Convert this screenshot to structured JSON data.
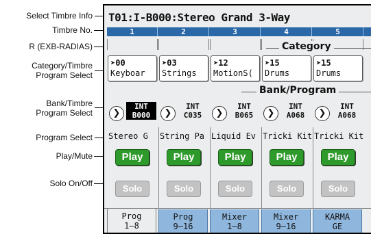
{
  "callouts": {
    "select_timbre_info": "Select Timbre Info",
    "timbre_no": "Timbre No.",
    "radias": "R (EXB-RADIAS)",
    "category_select_1": "Category/Timbre",
    "category_select_2": "Program Select",
    "bank_select_1": "Bank/Timbre",
    "bank_select_2": "Program Select",
    "program_select": "Program Select",
    "play_mute": "Play/Mute",
    "solo": "Solo On/Off"
  },
  "screen": {
    "title": "T01:I-B000:Stereo Grand 3-Way",
    "category_label": "Category",
    "bank_label": "Bank/Program"
  },
  "timbres": [
    {
      "no": "1",
      "cat_num": "00",
      "cat_name": "Keyboar",
      "bank": "INT",
      "prog": "B000",
      "name": "Stereo G",
      "play": "Play",
      "solo": "Solo"
    },
    {
      "no": "2",
      "cat_num": "03",
      "cat_name": "Strings",
      "bank": "INT",
      "prog": "C035",
      "name": "String Pa",
      "play": "Play",
      "solo": "Solo"
    },
    {
      "no": "3",
      "cat_num": "12",
      "cat_name": "MotionS(",
      "bank": "INT",
      "prog": "B065",
      "name": "Liquid Ev",
      "play": "Play",
      "solo": "Solo"
    },
    {
      "no": "4",
      "cat_num": "15",
      "cat_name": "Drums",
      "bank": "INT",
      "prog": "A068",
      "name": "Tricki Kit",
      "play": "Play",
      "solo": "Solo"
    },
    {
      "no": "5",
      "cat_num": "15",
      "cat_name": "Drums",
      "bank": "INT",
      "prog": "A068",
      "name": "Tricki Kit",
      "play": "Play",
      "solo": "Solo"
    }
  ],
  "tabs": [
    {
      "l1": "Prog",
      "l2": "1–8",
      "active": true
    },
    {
      "l1": "Prog",
      "l2": "9–16",
      "active": false
    },
    {
      "l1": "Mixer",
      "l2": "1–8",
      "active": false
    },
    {
      "l1": "Mixer",
      "l2": "9–16",
      "active": false
    },
    {
      "l1": "KARMA",
      "l2": "GE",
      "active": false
    }
  ],
  "glyphs": {
    "cat_arrow": "➤",
    "bank_arrow": "❯"
  },
  "colors": {
    "timbre_bar": "#2a68a8",
    "play_green": "#2f9a2c",
    "solo_gray": "#c3c3c3",
    "tab_blue": "#8fb6dd"
  }
}
